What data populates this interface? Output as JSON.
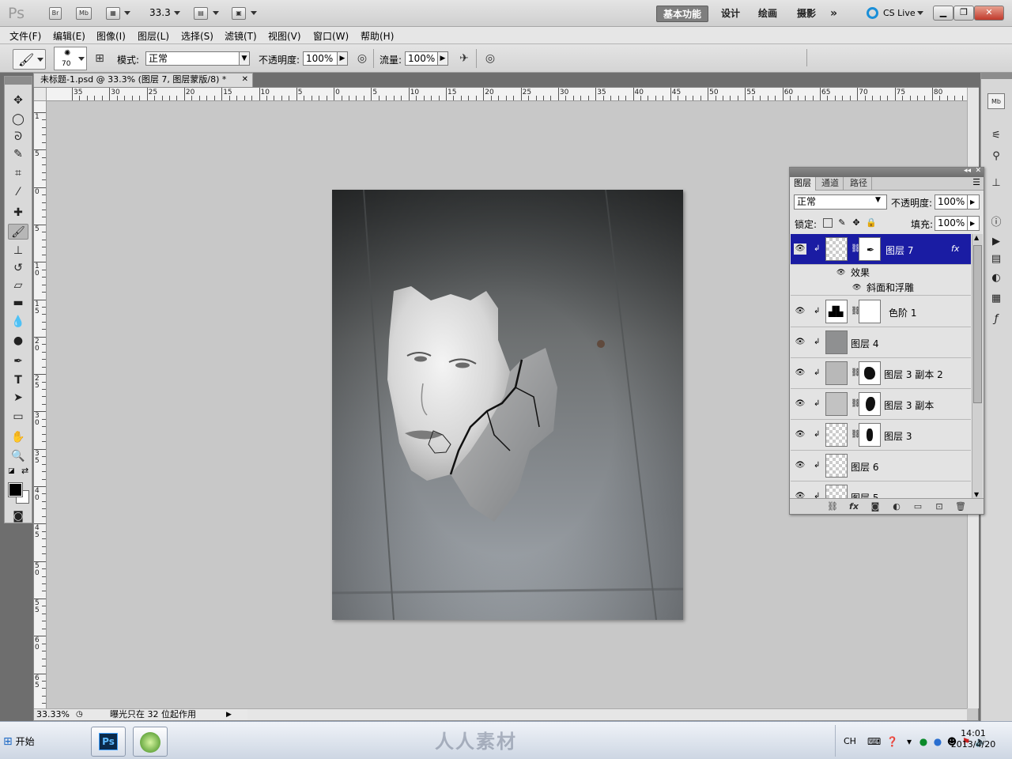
{
  "app": {
    "logo": "Ps",
    "bridge": "Br",
    "minibridge": "Mb",
    "zoom": "33.3",
    "workspaces": [
      "基本功能",
      "设计",
      "绘画",
      "摄影"
    ],
    "more": "»",
    "cslive": "CS Live"
  },
  "menus": [
    "文件(F)",
    "编辑(E)",
    "图像(I)",
    "图层(L)",
    "选择(S)",
    "滤镜(T)",
    "视图(V)",
    "窗口(W)",
    "帮助(H)"
  ],
  "options": {
    "brush_size": "70",
    "mode_label": "模式:",
    "mode_value": "正常",
    "opacity_label": "不透明度:",
    "opacity_value": "100%",
    "flow_label": "流量:",
    "flow_value": "100%"
  },
  "document": {
    "tab_title": "未标题-1.psd @ 33.3% (图层 7, 图层蒙版/8) *",
    "close": "✕",
    "zoom": "33.33%",
    "status": "曝光只在 32 位起作用",
    "hruler_labels": [
      "35",
      "30",
      "25",
      "20",
      "15",
      "10",
      "5",
      "0",
      "5",
      "10",
      "15",
      "20",
      "25",
      "30",
      "35",
      "40",
      "45",
      "50",
      "55",
      "60",
      "65",
      "70",
      "75",
      "80"
    ],
    "vruler_labels": [
      "1",
      "5",
      "0",
      "5",
      "1 0",
      "1 5",
      "2 0",
      "2 5",
      "3 0",
      "3 5",
      "4 0",
      "4 5",
      "5 0",
      "5 5",
      "6 0",
      "6 5"
    ]
  },
  "layers_panel": {
    "tabs": [
      "图层",
      "通道",
      "路径"
    ],
    "blend_mode": "正常",
    "opacity_label": "不透明度:",
    "opacity_value": "100%",
    "lock_label": "锁定:",
    "fill_label": "填充:",
    "fill_value": "100%",
    "effects_label": "效果",
    "bevel_label": "斜面和浮雕",
    "layers": [
      {
        "name": "图层 7",
        "selected": true,
        "has_mask": true,
        "fx": "fx"
      },
      {
        "name": "色阶 1",
        "selected": false,
        "has_mask": true
      },
      {
        "name": "图层 4",
        "selected": false,
        "has_mask": false
      },
      {
        "name": "图层 3 副本 2",
        "selected": false,
        "has_mask": true
      },
      {
        "name": "图层 3 副本",
        "selected": false,
        "has_mask": true
      },
      {
        "name": "图层 3",
        "selected": false,
        "has_mask": true
      },
      {
        "name": "图层 6",
        "selected": false,
        "has_mask": false
      },
      {
        "name": "图层 5",
        "selected": false,
        "has_mask": false
      }
    ]
  },
  "taskbar": {
    "start": "开始",
    "watermark": "人人素材",
    "lang": "CH",
    "time": "14:01",
    "date": "2013/4/20"
  }
}
